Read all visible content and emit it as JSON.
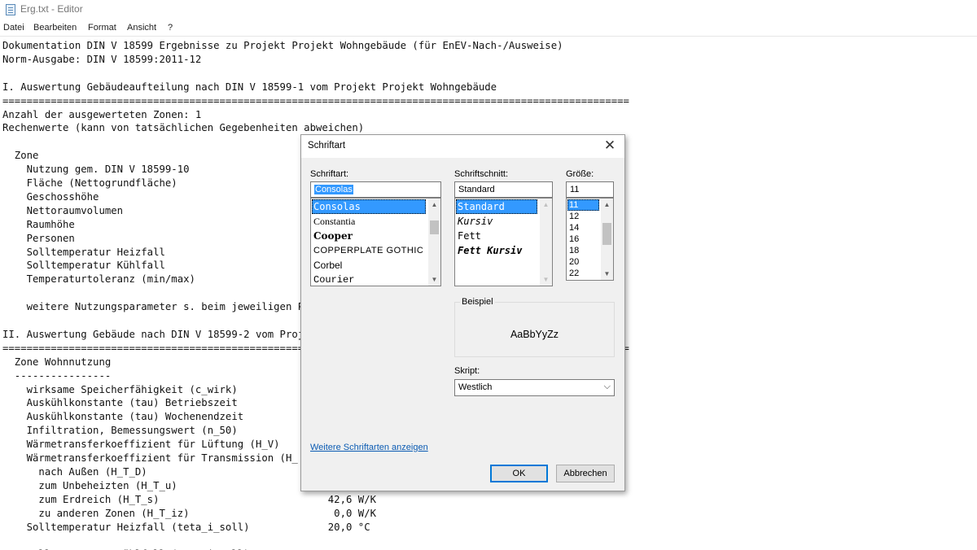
{
  "window": {
    "title": "Erg.txt - Editor",
    "icon": "notepad-icon"
  },
  "menu": [
    "Datei",
    "Bearbeiten",
    "Format",
    "Ansicht",
    "?"
  ],
  "editor_lines": [
    "Dokumentation DIN V 18599 Ergebnisse zu Projekt Projekt Wohngebäude (für EnEV-Nach-/Ausweise)",
    "Norm-Ausgabe: DIN V 18599:2011-12",
    "",
    "I. Auswertung Gebäudeaufteilung nach DIN V 18599-1 vom Projekt Projekt Wohngebäude",
    "========================================================================================================",
    "Anzahl der ausgewerteten Zonen: 1",
    "Rechenwerte (kann von tatsächlichen Gegebenheiten abweichen)",
    "",
    "  Zone",
    "    Nutzung gem. DIN V 18599-10",
    "    Fläche (Nettogrundfläche)",
    "    Geschosshöhe",
    "    Nettoraumvolumen",
    "    Raumhöhe",
    "    Personen",
    "    Solltemperatur Heizfall",
    "    Solltemperatur Kühlfall",
    "    Temperaturtoleranz (min/max)",
    "",
    "    weitere Nutzungsparameter s. beim jeweiligen Pro",
    "",
    "II. Auswertung Gebäude nach DIN V 18599-2 vom Proj",
    "========================================================================================================",
    "  Zone Wohnnutzung",
    "  ----------------",
    "    wirksame Speicherfähigkeit (c_wirk)",
    "    Auskühlkonstante (tau) Betriebszeit",
    "    Auskühlkonstante (tau) Wochenendzeit",
    "    Infiltration, Bemessungswert (n_50)",
    "    Wärmetransferkoeffizient für Lüftung (H_V)",
    "    Wärmetransferkoeffizient für Transmission (H_",
    "      nach Außen (H_T_D)",
    "      zum Unbeheizten (H_T_u)",
    "      zum Erdreich (H_T_s)                            42,6 W/K",
    "      zu anderen Zonen (H_T_iz)                        0,0 W/K",
    "    Solltemperatur Heizfall (teta_i_soll)             20,0 °C",
    "",
    "    Solltemperatur Kühlfall (teta_i_soll)"
  ],
  "dialog": {
    "title": "Schriftart",
    "close_icon": "close-icon",
    "font_label": "Schriftart:",
    "font_value": "Consolas",
    "fonts": [
      "Consolas",
      "Constantia",
      "Cooper",
      "COPPERPLATE GOTHIC",
      "Corbel",
      "Courier"
    ],
    "style_label": "Schriftschnitt:",
    "style_value": "Standard",
    "styles": [
      "Standard",
      "Kursiv",
      "Fett",
      "Fett Kursiv"
    ],
    "size_label": "Größe:",
    "size_value": "11",
    "sizes": [
      "11",
      "12",
      "14",
      "16",
      "18",
      "20",
      "22"
    ],
    "sample_label": "Beispiel",
    "sample_text": "AaBbYyZz",
    "script_label": "Skript:",
    "script_value": "Westlich",
    "more_fonts_link": "Weitere Schriftarten anzeigen",
    "ok_label": "OK",
    "cancel_label": "Abbrechen",
    "accent": "#3399ff"
  }
}
